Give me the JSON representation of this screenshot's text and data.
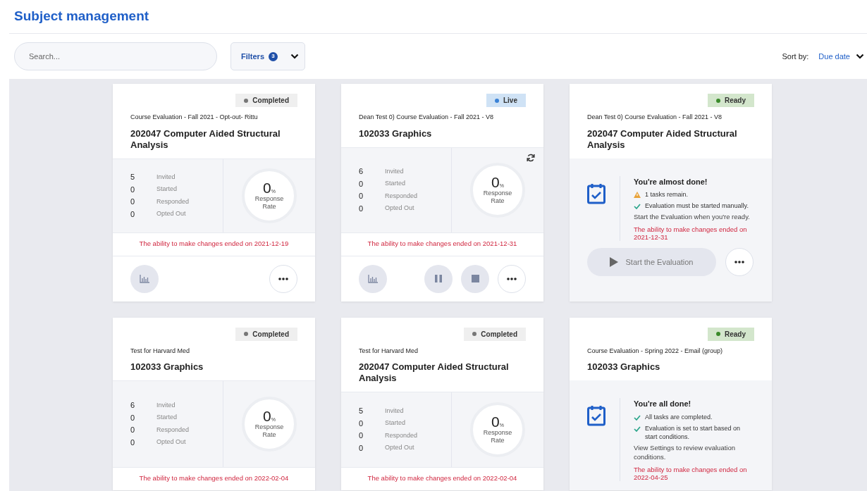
{
  "page": {
    "title": "Subject management"
  },
  "toolbar": {
    "search": {
      "placeholder": "Search..."
    },
    "filters": {
      "label": "Filters",
      "count": "3"
    },
    "sort": {
      "label": "Sort by:",
      "value": "Due date"
    }
  },
  "cards": [
    {
      "kind": "stats",
      "status": {
        "kind": "completed",
        "label": "Completed"
      },
      "subtitle": "Course Evaluation - Fall 2021 - Opt-out- Rittu",
      "title": "202047 Computer Aided Structural Analysis",
      "stats": [
        {
          "value": "5",
          "label": "Invited"
        },
        {
          "value": "0",
          "label": "Started"
        },
        {
          "value": "0",
          "label": "Responded"
        },
        {
          "value": "0",
          "label": "Opted Out"
        }
      ],
      "rate": {
        "value": "0",
        "unit": "%",
        "label": "Response Rate"
      },
      "refresh": false,
      "deadline": "The ability to make changes ended on 2021-12-19",
      "actions": [
        {
          "kind": "report"
        },
        {
          "kind": "spacer"
        },
        {
          "kind": "more"
        }
      ]
    },
    {
      "kind": "stats",
      "status": {
        "kind": "live",
        "label": "Live"
      },
      "subtitle": "Dean Test 0) Course Evaluation - Fall 2021 - V8",
      "title": "102033 Graphics",
      "stats": [
        {
          "value": "6",
          "label": "Invited"
        },
        {
          "value": "0",
          "label": "Started"
        },
        {
          "value": "0",
          "label": "Responded"
        },
        {
          "value": "0",
          "label": "Opted Out"
        }
      ],
      "rate": {
        "value": "0",
        "unit": "%",
        "label": "Response Rate"
      },
      "refresh": true,
      "deadline": "The ability to make changes ended on 2021-12-31",
      "actions": [
        {
          "kind": "report"
        },
        {
          "kind": "spacer"
        },
        {
          "kind": "pause"
        },
        {
          "kind": "stop"
        },
        {
          "kind": "more"
        }
      ]
    },
    {
      "kind": "tasks",
      "status": {
        "kind": "ready",
        "label": "Ready"
      },
      "subtitle": "Dean Test 0) Course Evaluation - Fall 2021 - V8",
      "title": "202047 Computer Aided Structural Analysis",
      "heading": "You're almost done!",
      "tasks": [
        {
          "kind": "warning",
          "text": "1 tasks remain."
        },
        {
          "kind": "check",
          "text": "Evaluation must be started manually."
        }
      ],
      "note": "Start the Evaluation when you're ready.",
      "deadline": "The ability to make changes ended on 2021-12-31",
      "actions": [
        {
          "kind": "start",
          "label": "Start the Evaluation"
        },
        {
          "kind": "more"
        }
      ]
    },
    {
      "kind": "stats",
      "status": {
        "kind": "completed",
        "label": "Completed"
      },
      "subtitle": "Test for Harvard Med",
      "title": "102033 Graphics",
      "stats": [
        {
          "value": "6",
          "label": "Invited"
        },
        {
          "value": "0",
          "label": "Started"
        },
        {
          "value": "0",
          "label": "Responded"
        },
        {
          "value": "0",
          "label": "Opted Out"
        }
      ],
      "rate": {
        "value": "0",
        "unit": "%",
        "label": "Response Rate"
      },
      "refresh": false,
      "deadline": "The ability to make changes ended on 2022-02-04"
    },
    {
      "kind": "stats",
      "status": {
        "kind": "completed",
        "label": "Completed"
      },
      "subtitle": "Test for Harvard Med",
      "title": "202047 Computer Aided Structural Analysis",
      "stats": [
        {
          "value": "5",
          "label": "Invited"
        },
        {
          "value": "0",
          "label": "Started"
        },
        {
          "value": "0",
          "label": "Responded"
        },
        {
          "value": "0",
          "label": "Opted Out"
        }
      ],
      "rate": {
        "value": "0",
        "unit": "%",
        "label": "Response Rate"
      },
      "refresh": false,
      "deadline": "The ability to make changes ended on 2022-02-04"
    },
    {
      "kind": "tasks",
      "status": {
        "kind": "ready",
        "label": "Ready"
      },
      "subtitle": "Course Evaluation - Spring 2022 - Email (group)",
      "title": "102033 Graphics",
      "heading": "You're all done!",
      "tasks": [
        {
          "kind": "check",
          "text": "All tasks are completed."
        },
        {
          "kind": "check",
          "text": "Evaluation is set to start based on start conditions."
        }
      ],
      "note": "View Settings to review evaluation conditions.",
      "deadline": "The ability to make changes ended on 2022-04-25"
    }
  ]
}
